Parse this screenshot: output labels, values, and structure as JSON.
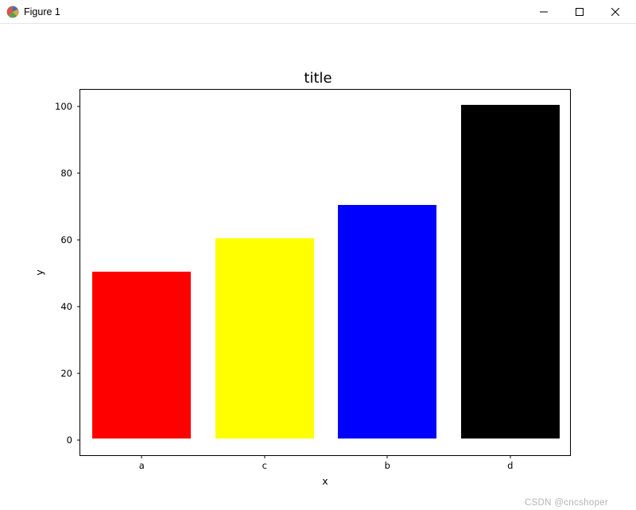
{
  "window": {
    "title": "Figure 1"
  },
  "chart_data": {
    "type": "bar",
    "title": "title",
    "xlabel": "x",
    "ylabel": "y",
    "categories": [
      "a",
      "c",
      "b",
      "d"
    ],
    "values": [
      50,
      60,
      70,
      100
    ],
    "colors": [
      "#ff0000",
      "#ffff00",
      "#0000ff",
      "#000000"
    ],
    "ylim": [
      0,
      100
    ],
    "yticks": [
      0,
      20,
      40,
      60,
      80,
      100
    ]
  },
  "watermark": "CSDN @cncshoper"
}
